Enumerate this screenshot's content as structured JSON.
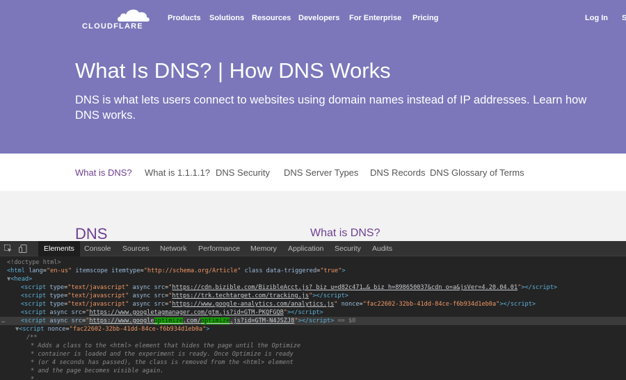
{
  "brand": {
    "logo_text": "CLOUDFLARE"
  },
  "topnav": {
    "items": [
      "Products",
      "Solutions",
      "Resources",
      "Developers",
      "For Enterprise",
      "Pricing"
    ],
    "login": "Log In",
    "cut_item": "S"
  },
  "hero": {
    "title": "What Is DNS? | How DNS Works",
    "subtitle": "DNS is what lets users connect to websites using domain names instead of IP addresses. Learn how DNS works."
  },
  "subnav": {
    "items": [
      "What is DNS?",
      "What is 1.1.1.1?",
      "DNS Security",
      "DNS Server Types",
      "DNS Records",
      "DNS Glossary of Terms"
    ],
    "active_index": 0
  },
  "content": {
    "heading": "DNS",
    "side_heading": "What is DNS?"
  },
  "devtools": {
    "tabs": [
      "Elements",
      "Console",
      "Sources",
      "Network",
      "Performance",
      "Memory",
      "Application",
      "Security",
      "Audits"
    ],
    "active_tab": "Elements",
    "code": {
      "doctype": "<!doctype html>",
      "html_lang": "en-us",
      "html_itemtype": "http://schema.org/Article",
      "html_data_triggered": "true",
      "head": "<head>",
      "script1_type": "text/javascript",
      "script1_src": "https://cdn.bizible.com/BizibleAcct.js?_biz_u=d82c471…&_biz_h=898650037&cdn_o=a&jsVer=4.20.04.01",
      "script2_type": "text/javascript",
      "script2_src": "https://trk.techtarget.com/tracking.js",
      "script3_type": "text/javascript",
      "script3_src": "https://www.google-analytics.com/analytics.js",
      "script3_nonce": "fac22602-32bb-41dd-84ce-f6b934d1eb0a",
      "script4_src": "https://www.googletagmanager.com/gtm.js?id=GTM-PKQFGQB",
      "script5_src_a": "https://www.google",
      "script5_src_hl1": "optimize",
      "script5_src_b": ".com/",
      "script5_src_hl2": "optimize",
      "script5_src_c": ".js?id=GTM-N4JSZJ8",
      "selected_marker": "== $0",
      "line_dots": "…",
      "script6_nonce": "fac22602-32bb-41dd-84ce-f6b934d1eb0a",
      "comment": [
        "/**",
        "* Adds a class to the <html> element that hides the page until the Optimize",
        "* container is loaded and the experiment is ready. Once Optimize is ready",
        "* (or 4 seconds has passed), the class is removed from the <html> element",
        "* and the page becomes visible again.",
        "*"
      ]
    }
  },
  "colors": {
    "hero_bg": "#7b77ba",
    "accent_purple": "#6e3f91",
    "devtools_bg": "#242424",
    "highlight": "#14a000"
  }
}
